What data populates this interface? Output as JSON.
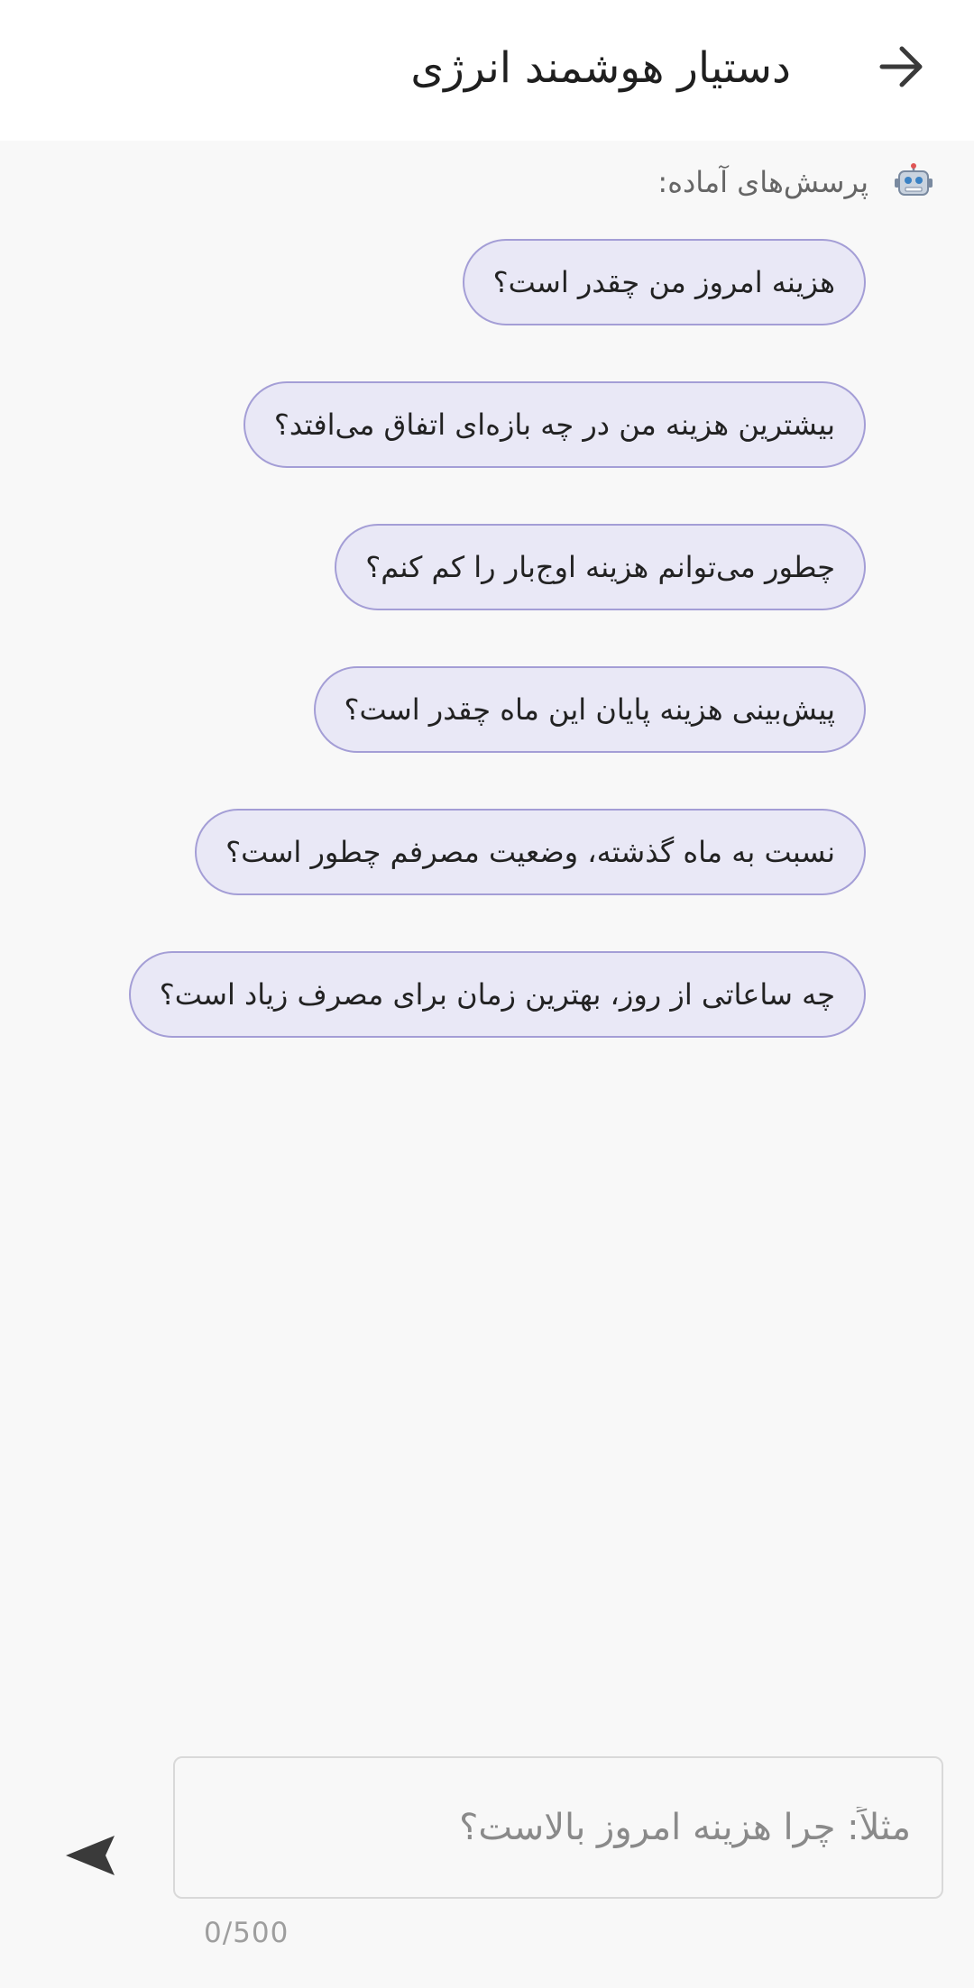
{
  "header": {
    "title": "دستیار هوشمند انرژی",
    "back_icon": "arrow-right-icon"
  },
  "prompts": {
    "icon": "robot-icon",
    "label": "پرسش‌های آماده:",
    "items": [
      "هزینه امروز من چقدر است؟",
      "بیشترین هزینه من در چه بازه‌ای اتفاق می‌افتد؟",
      "چطور می‌توانم هزینه اوج‌بار را کم کنم؟",
      "پیش‌بینی هزینه پایان این ماه چقدر است؟",
      "نسبت به ماه گذشته، وضعیت مصرفم چطور است؟",
      "چه ساعاتی از روز، بهترین زمان برای مصرف زیاد است؟"
    ]
  },
  "composer": {
    "placeholder": "مثلاً: چرا هزینه امروز بالاست؟",
    "value": "",
    "counter": "0/500",
    "send_icon": "send-icon"
  },
  "colors": {
    "chip_bg": "#e9e8f6",
    "chip_border": "#a49ed6",
    "background": "#f8f8f8"
  }
}
